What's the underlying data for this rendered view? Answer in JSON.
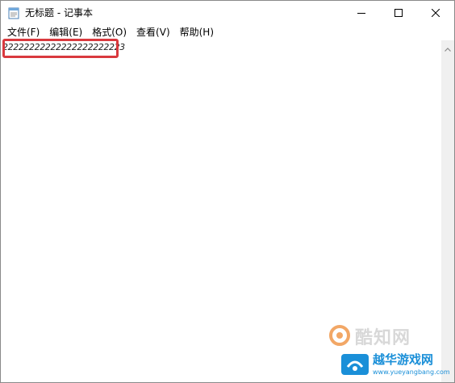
{
  "window": {
    "title": "无标题 - 记事本",
    "app_icon": "notepad-icon"
  },
  "controls": {
    "minimize_icon": "minimize-icon",
    "maximize_icon": "maximize-icon",
    "close_icon": "close-icon"
  },
  "menu": [
    {
      "label": "文件(F)"
    },
    {
      "label": "编辑(E)"
    },
    {
      "label": "格式(O)"
    },
    {
      "label": "查看(V)"
    },
    {
      "label": "帮助(H)"
    }
  ],
  "editor": {
    "content": "22222222222222222222223"
  },
  "watermarks": {
    "site1_text": "酷知网",
    "site2_text": "越华游戏网",
    "site2_url": "www.yueyangbang.com"
  },
  "colors": {
    "highlight": "#d9393e",
    "watermark_blue": "#1a8fd8"
  }
}
